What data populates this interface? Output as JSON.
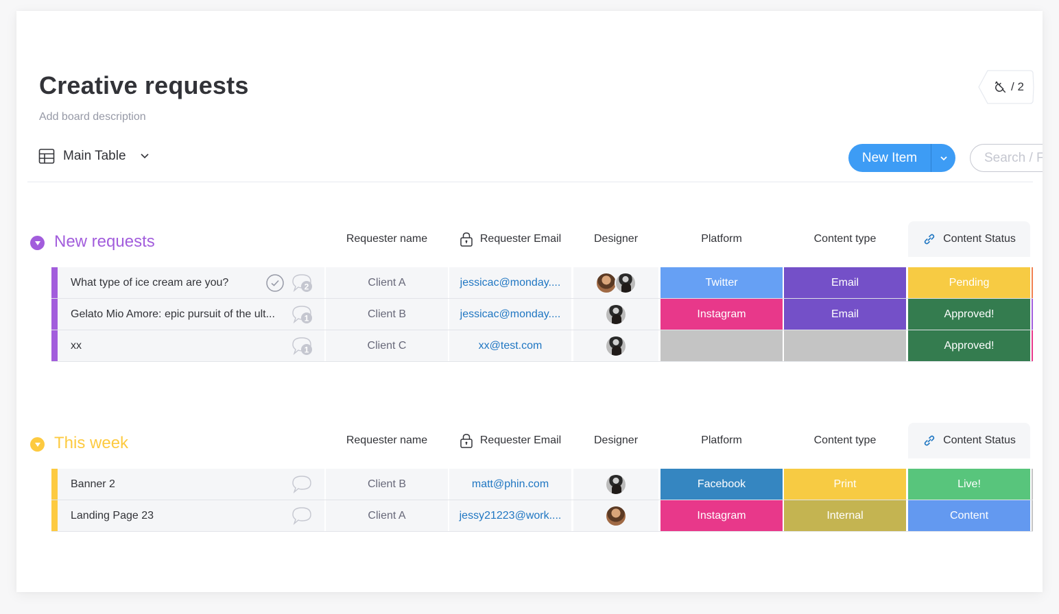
{
  "board": {
    "title": "Creative requests",
    "description_placeholder": "Add board description",
    "integrations_count": "/ 2"
  },
  "toolbar": {
    "view_name": "Main Table",
    "new_item_label": "New Item",
    "search_placeholder": "Search / Filter"
  },
  "columns": {
    "requester_name": "Requester name",
    "requester_email": "Requester Email",
    "designer": "Designer",
    "platform": "Platform",
    "content_type": "Content type",
    "content_status": "Content Status"
  },
  "colors": {
    "purple": "#a25ddc",
    "yellow": "#fdca40",
    "twitter": "#66a0f4",
    "instagram": "#e8388a",
    "facebook": "#3586c1",
    "email": "#7450c8",
    "print": "#f7cb43",
    "internal": "#c4b451",
    "pending": "#f7cb43",
    "approved": "#347c4f",
    "live": "#58c57c",
    "content": "#6399f0",
    "empty": "#c4c4c4",
    "link": "#1f76c2"
  },
  "groups": [
    {
      "name": "New requests",
      "color": "#a25ddc",
      "rows": [
        {
          "name": "What type of ice cream are you?",
          "updates": "2",
          "has_check": true,
          "client": "Client A",
          "email": "jessicac@monday....",
          "designers": [
            "a1",
            "a2"
          ],
          "platform": "Twitter",
          "platform_color": "#66a0f4",
          "content_type": "Email",
          "content_type_color": "#7450c8",
          "status": "Pending",
          "status_color": "#f7cb43",
          "edge_color": "#f2804f"
        },
        {
          "name": "Gelato Mio Amore: epic pursuit of the ult...",
          "updates": "1",
          "has_check": false,
          "client": "Client B",
          "email": "jessicac@monday....",
          "designers": [
            "a2"
          ],
          "platform": "Instagram",
          "platform_color": "#e8388a",
          "content_type": "Email",
          "content_type_color": "#7450c8",
          "status": "Approved!",
          "status_color": "#347c4f",
          "edge_color": "#a25ddc"
        },
        {
          "name": "xx",
          "updates": "1",
          "has_check": false,
          "client": "Client C",
          "email": "xx@test.com",
          "designers": [
            "a2"
          ],
          "platform": "",
          "platform_color": "#c4c4c4",
          "content_type": "",
          "content_type_color": "#c4c4c4",
          "status": "Approved!",
          "status_color": "#347c4f",
          "edge_color": "#e8388a"
        }
      ]
    },
    {
      "name": "This week",
      "color": "#fdca40",
      "rows": [
        {
          "name": "Banner 2",
          "updates": "",
          "has_check": false,
          "client": "Client B",
          "email": "matt@phin.com",
          "designers": [
            "a2"
          ],
          "platform": "Facebook",
          "platform_color": "#3586c1",
          "content_type": "Print",
          "content_type_color": "#f7cb43",
          "status": "Live!",
          "status_color": "#58c57c",
          "edge_color": "#c4c4c4"
        },
        {
          "name": "Landing Page 23",
          "updates": "",
          "has_check": false,
          "client": "Client A",
          "email": "jessy21223@work....",
          "designers": [
            "a1"
          ],
          "platform": "Instagram",
          "platform_color": "#e8388a",
          "content_type": "Internal",
          "content_type_color": "#c4b451",
          "status": "Content",
          "status_color": "#6399f0",
          "edge_color": "#c4c4c4"
        }
      ]
    }
  ]
}
